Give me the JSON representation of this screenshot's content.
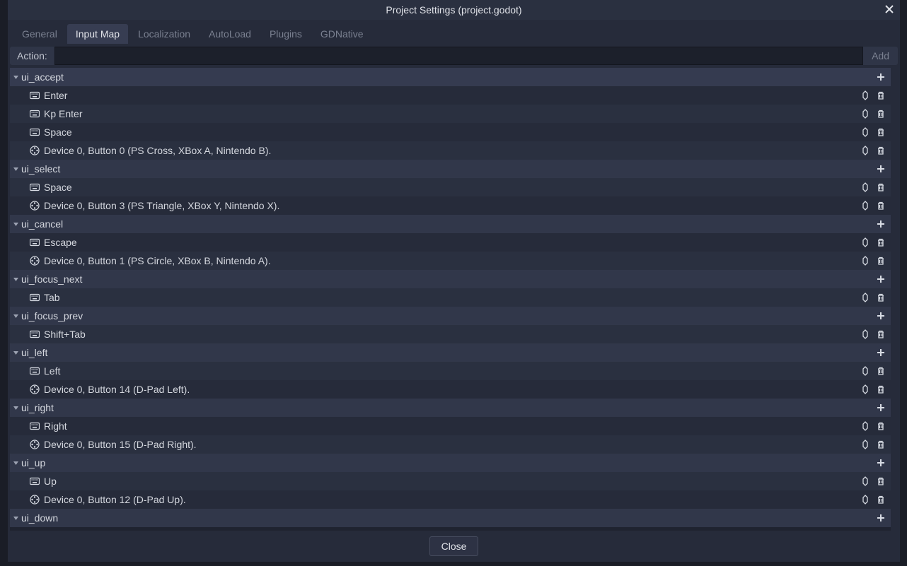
{
  "title": "Project Settings (project.godot)",
  "tabs": [
    "General",
    "Input Map",
    "Localization",
    "AutoLoad",
    "Plugins",
    "GDNative"
  ],
  "active_tab": 1,
  "action_label": "Action:",
  "action_value": "",
  "add_label": "Add",
  "close_label": "Close",
  "actions": [
    {
      "name": "ui_accept",
      "events": [
        {
          "type": "key",
          "label": "Enter"
        },
        {
          "type": "key",
          "label": "Kp Enter"
        },
        {
          "type": "key",
          "label": "Space"
        },
        {
          "type": "joy",
          "label": "Device 0, Button 0 (PS Cross, XBox A, Nintendo B)."
        }
      ]
    },
    {
      "name": "ui_select",
      "events": [
        {
          "type": "key",
          "label": "Space"
        },
        {
          "type": "joy",
          "label": "Device 0, Button 3 (PS Triangle, XBox Y, Nintendo X)."
        }
      ]
    },
    {
      "name": "ui_cancel",
      "events": [
        {
          "type": "key",
          "label": "Escape"
        },
        {
          "type": "joy",
          "label": "Device 0, Button 1 (PS Circle, XBox B, Nintendo A)."
        }
      ]
    },
    {
      "name": "ui_focus_next",
      "events": [
        {
          "type": "key",
          "label": "Tab"
        }
      ]
    },
    {
      "name": "ui_focus_prev",
      "events": [
        {
          "type": "key",
          "label": "Shift+Tab"
        }
      ]
    },
    {
      "name": "ui_left",
      "events": [
        {
          "type": "key",
          "label": "Left"
        },
        {
          "type": "joy",
          "label": "Device 0, Button 14 (D-Pad Left)."
        }
      ]
    },
    {
      "name": "ui_right",
      "events": [
        {
          "type": "key",
          "label": "Right"
        },
        {
          "type": "joy",
          "label": "Device 0, Button 15 (D-Pad Right)."
        }
      ]
    },
    {
      "name": "ui_up",
      "events": [
        {
          "type": "key",
          "label": "Up"
        },
        {
          "type": "joy",
          "label": "Device 0, Button 12 (D-Pad Up)."
        }
      ]
    },
    {
      "name": "ui_down",
      "events": []
    }
  ]
}
